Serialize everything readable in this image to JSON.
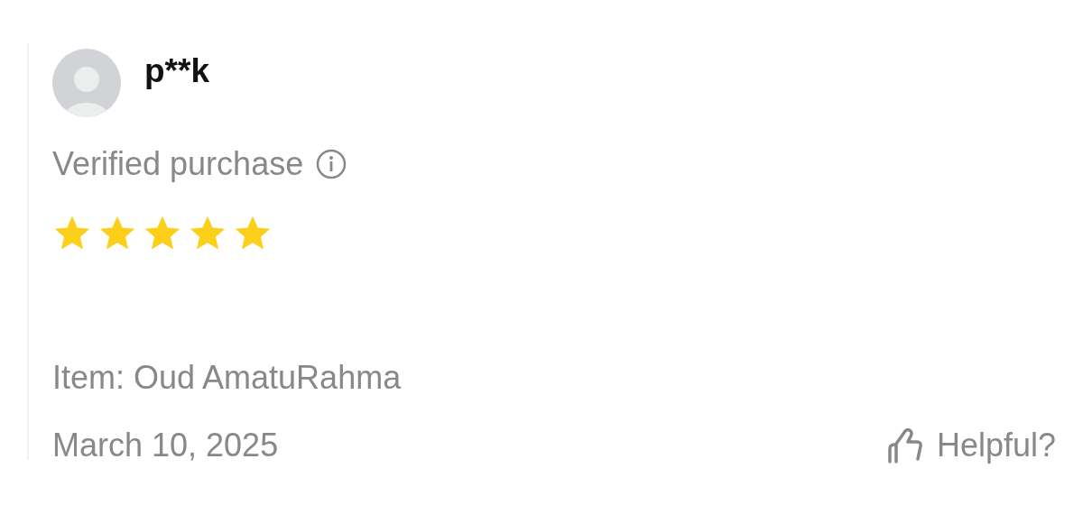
{
  "review": {
    "reviewer": "p**k",
    "verified_label": "Verified purchase",
    "stars": 5,
    "item": "Item: Oud AmatuRahma",
    "date": "March 10, 2025",
    "helpful_label": "Helpful?"
  }
}
